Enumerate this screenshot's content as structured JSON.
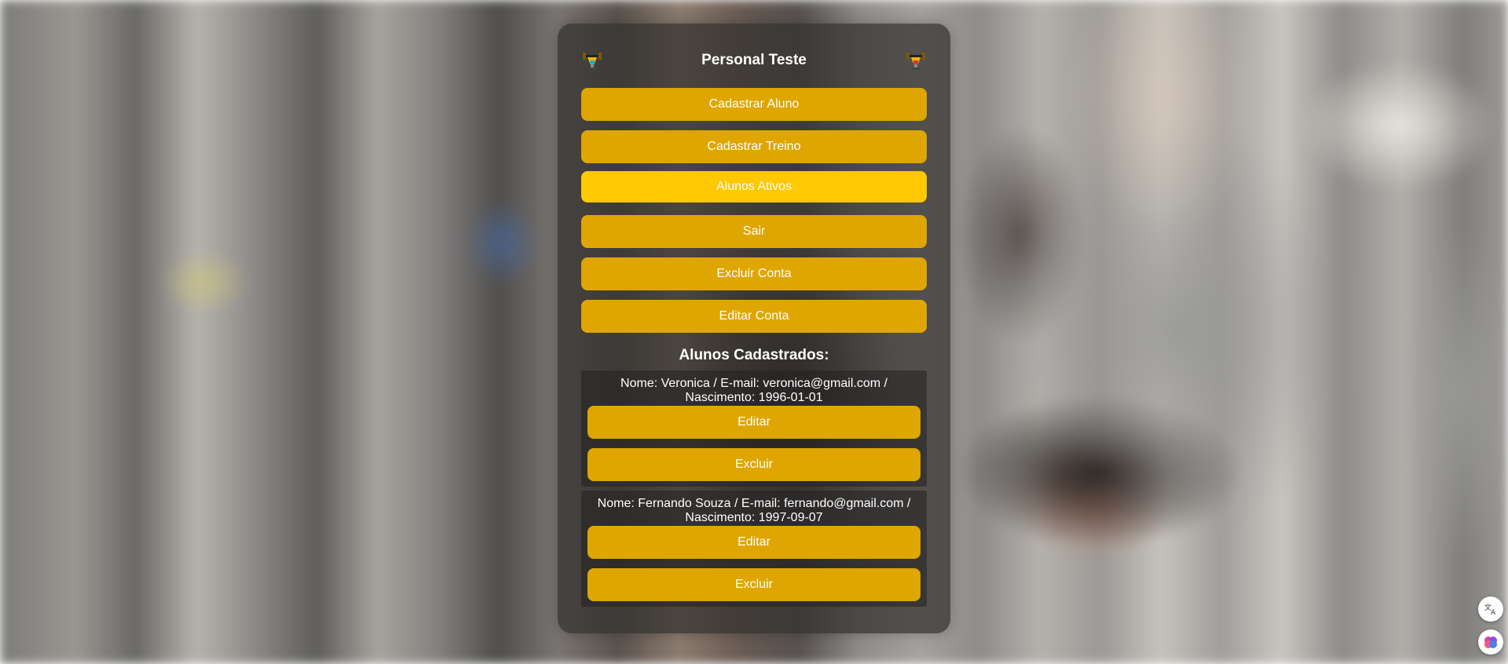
{
  "header": {
    "title": "Personal Teste",
    "logo_icon": "dumbbell-trophy-icon"
  },
  "menu": [
    {
      "label": "Cadastrar Aluno",
      "active": false
    },
    {
      "label": "Cadastrar Treino",
      "active": false
    },
    {
      "label": "Alunos Ativos",
      "active": true
    },
    {
      "label": "Sair",
      "active": false
    },
    {
      "label": "Excluir Conta",
      "active": false
    },
    {
      "label": "Editar Conta",
      "active": false
    }
  ],
  "students_section": {
    "title": "Alunos Cadastrados:",
    "students": [
      {
        "info_line1": "Nome: Veronica / E-mail: veronica@gmail.com /",
        "info_line2": "Nascimento: 1996-01-01",
        "edit_label": "Editar",
        "delete_label": "Excluir"
      },
      {
        "info_line1": "Nome: Fernando Souza / E-mail: fernando@gmail.com /",
        "info_line2": "Nascimento: 1997-09-07",
        "edit_label": "Editar",
        "delete_label": "Excluir"
      }
    ]
  },
  "floating_buttons": [
    "translate-icon",
    "brain-icon"
  ],
  "colors": {
    "button": "#dfa602",
    "button_active": "#ffc800",
    "panel": "#32302e"
  }
}
